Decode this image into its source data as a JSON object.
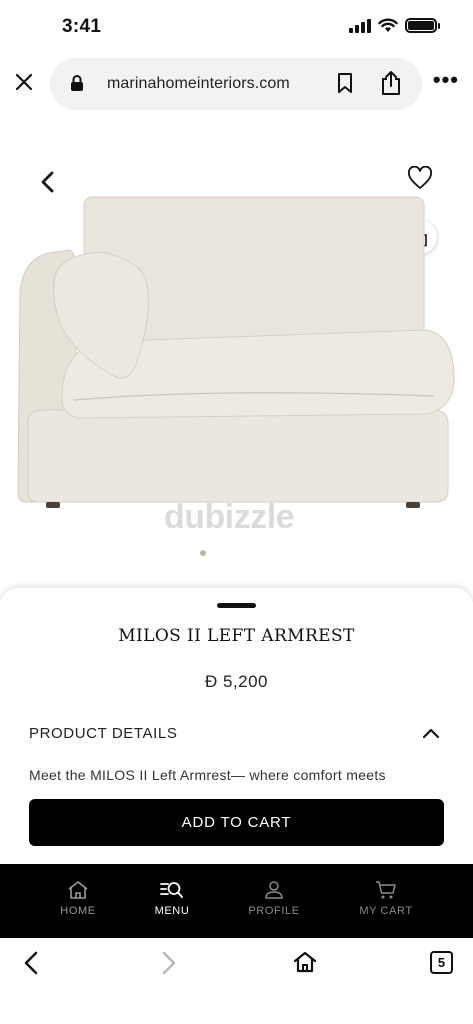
{
  "status_bar": {
    "time": "3:41"
  },
  "browser": {
    "url": "marinahomeinteriors.com",
    "tab_count": "5"
  },
  "hero": {
    "watermark": "dubizzle",
    "page_indicator": {
      "current": 1,
      "total": 1
    }
  },
  "product": {
    "title": "MILOS II LEFT ARMREST",
    "price": "Đ 5,200",
    "details_heading": "PRODUCT DETAILS",
    "details_text": "Meet the MILOS II Left Armrest— where comfort meets",
    "add_to_cart_label": "ADD TO CART"
  },
  "site_nav": {
    "items": [
      {
        "label": "HOME",
        "icon": "home-icon"
      },
      {
        "label": "MENU",
        "icon": "menu-search-icon"
      },
      {
        "label": "PROFILE",
        "icon": "user-icon"
      },
      {
        "label": "MY CART",
        "icon": "cart-icon"
      }
    ]
  },
  "colors": {
    "sofa": "#ece8df",
    "button": "#000000",
    "nav_background": "#000000",
    "nav_active": "#ffffff",
    "nav_inactive": "#8a8a8a"
  }
}
